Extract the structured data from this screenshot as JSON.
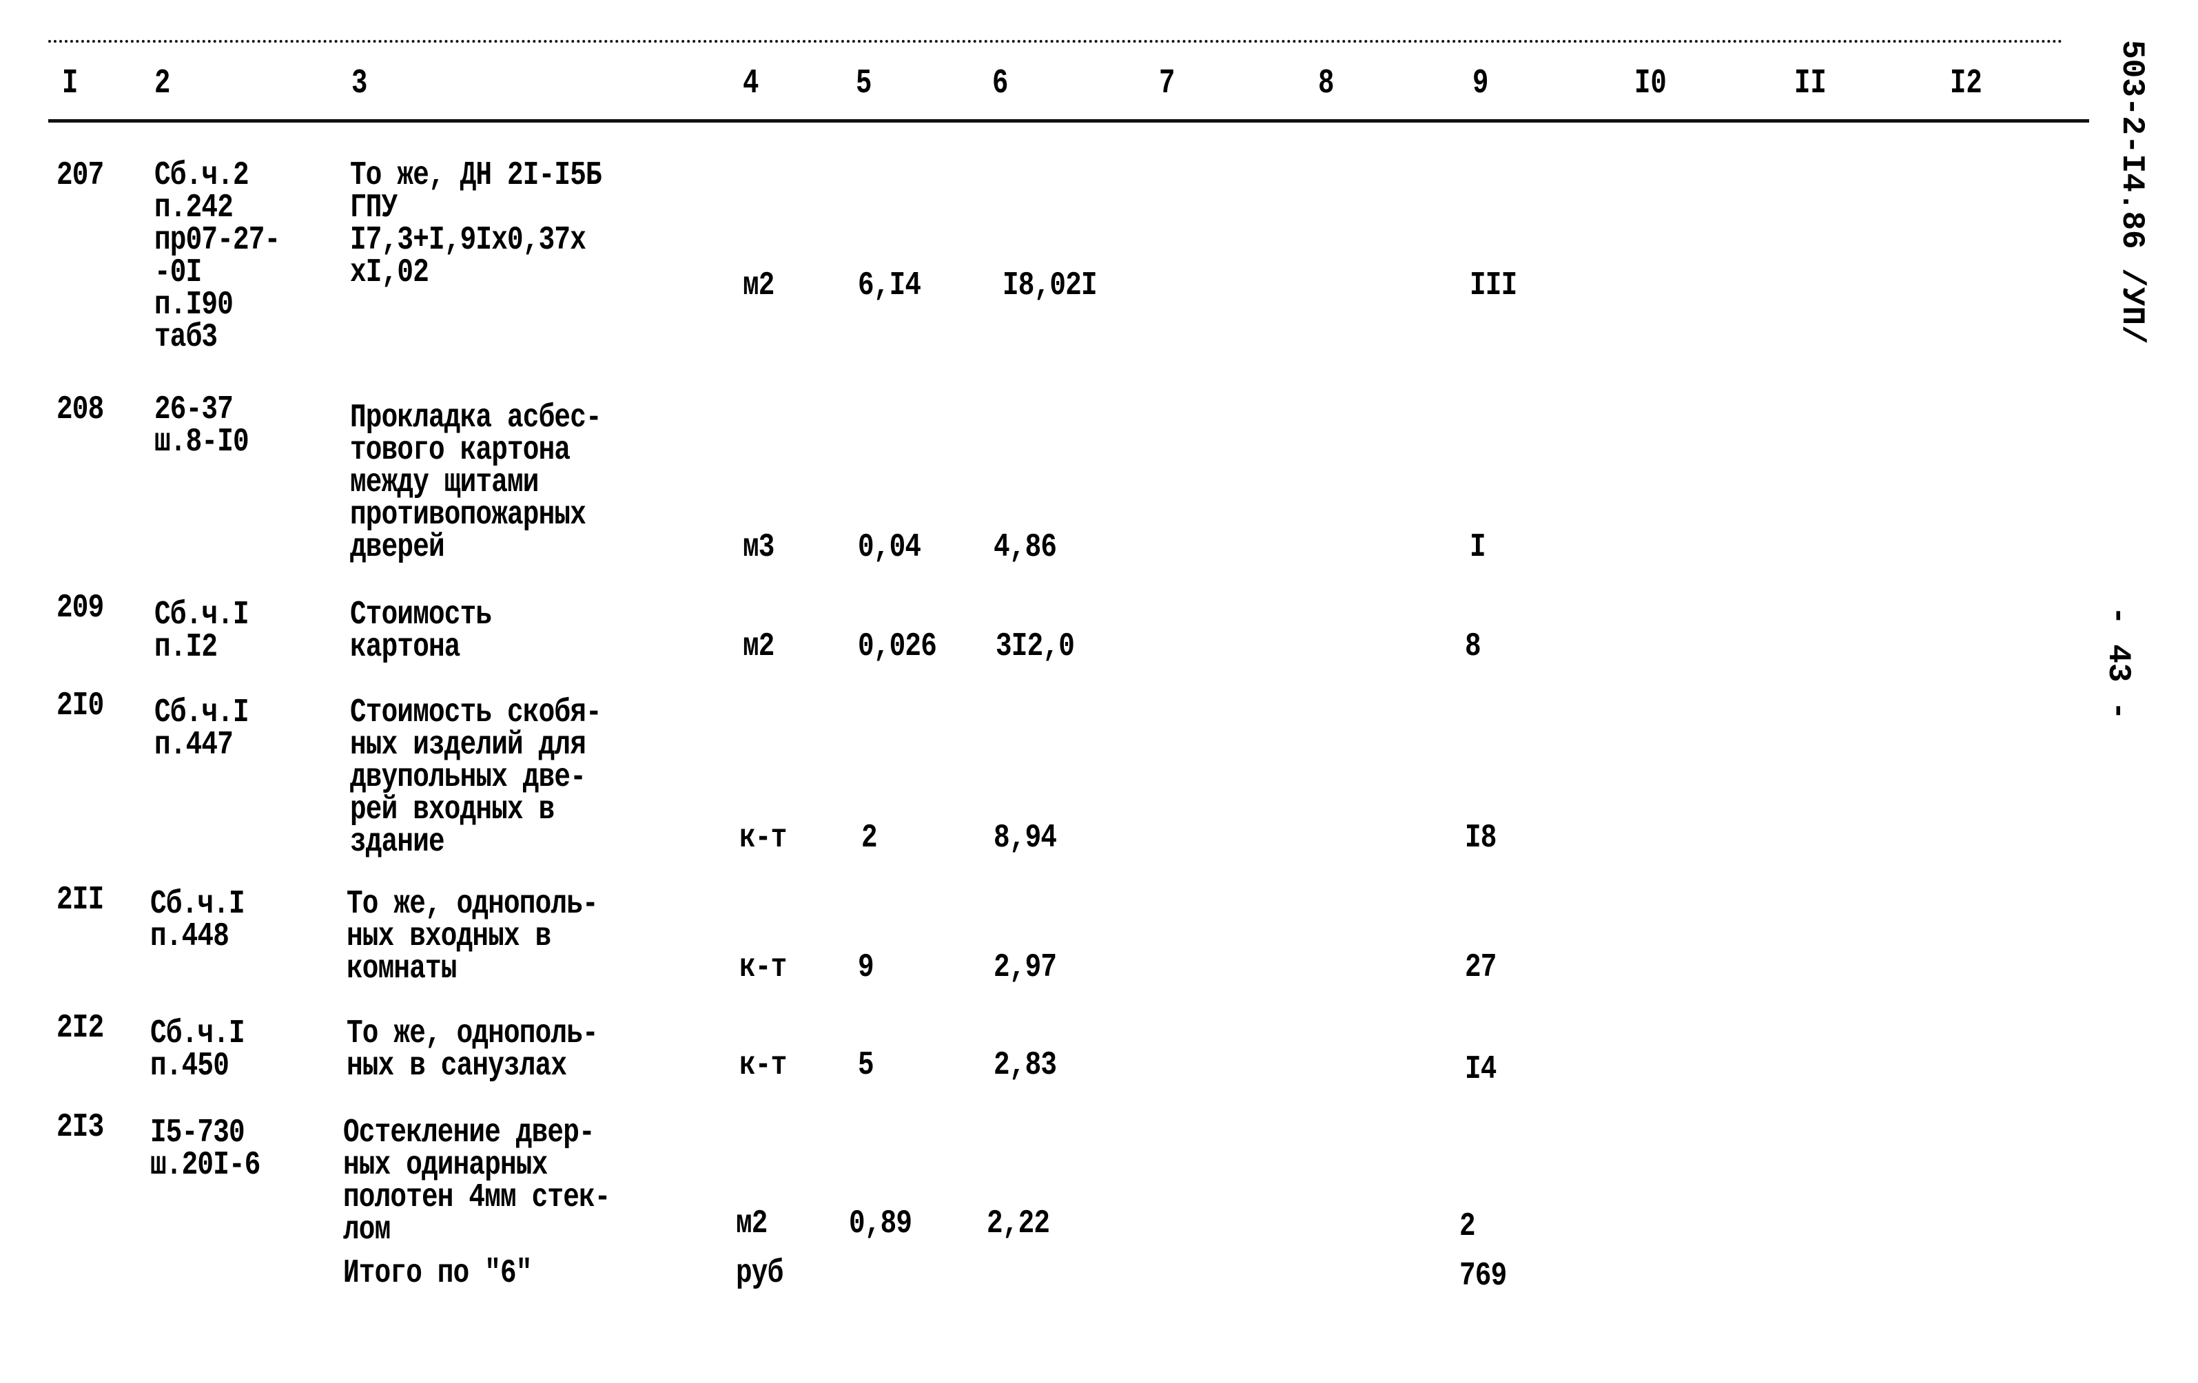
{
  "document_code": "503-2-I4.86 /УП/",
  "page_number": "- 43 -",
  "columns": [
    "I",
    "2",
    "3",
    "4",
    "5",
    "6",
    "7",
    "8",
    "9",
    "I0",
    "II",
    "I2"
  ],
  "rows": [
    {
      "num": "207",
      "ref": "Сб.ч.2\nп.242\nпр07-27-\n-0I\nп.I90\nтаб3",
      "desc": "То же, ДН 2I-I5Б\nГПУ\nI7,3+I,9Ix0,37x\nxI,02",
      "unit": "м2",
      "qty": "6,I4",
      "price": "I8,02I",
      "total": "III"
    },
    {
      "num": "208",
      "ref": "26-37\nш.8-I0",
      "desc": "Прокладка асбес-\nтового картона\nмежду щитами\nпротивопожарных\nдверей",
      "unit": "м3",
      "qty": "0,04",
      "price": "4,86",
      "total": "I"
    },
    {
      "num": "209",
      "ref": "Сб.ч.I\nп.I2",
      "desc": "Стоимость\nкартона",
      "unit": "м2",
      "qty": "0,026",
      "price": "3I2,0",
      "total": "8"
    },
    {
      "num": "2I0",
      "ref": "Сб.ч.I\nп.447",
      "desc": "Стоимость скобя-\nных изделий для\nдвупольных две-\nрей входных в\nздание",
      "unit": "к-т",
      "qty": "2",
      "price": "8,94",
      "total": "I8"
    },
    {
      "num": "2II",
      "ref": "Сб.ч.I\nп.448",
      "desc": "То же, однополь-\nных входных в\nкомнаты",
      "unit": "к-т",
      "qty": "9",
      "price": "2,97",
      "total": "27"
    },
    {
      "num": "2I2",
      "ref": "Сб.ч.I\nп.450",
      "desc": "То же, однополь-\nных в санузлах",
      "unit": "к-т",
      "qty": "5",
      "price": "2,83",
      "total": "I4"
    },
    {
      "num": "2I3",
      "ref": "I5-730\nш.20I-6",
      "desc": "Остекление двер-\nных одинарных\nполотен 4мм стек-\nлом",
      "unit": "м2",
      "qty": "0,89",
      "price": "2,22",
      "total": "2"
    }
  ],
  "summary": {
    "label": "Итого по \"6\"",
    "unit": "руб",
    "total": "769"
  }
}
